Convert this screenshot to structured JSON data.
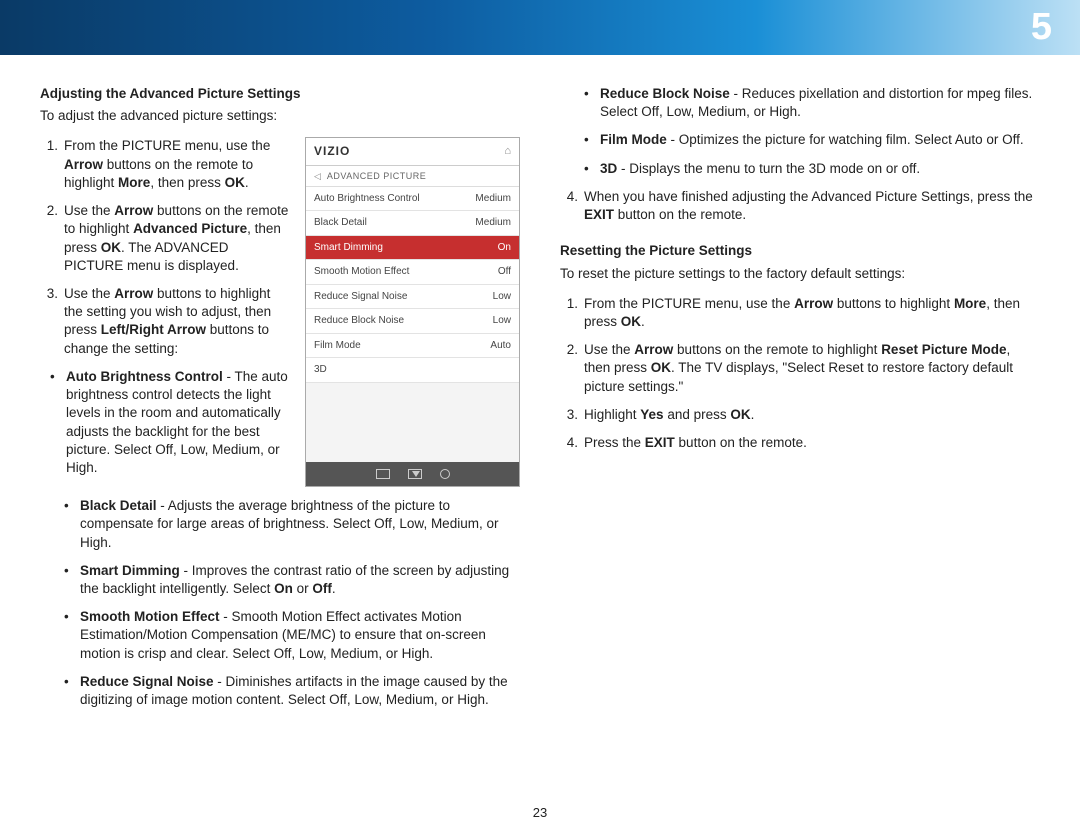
{
  "chapter_number": "5",
  "page_number": "23",
  "left": {
    "heading": "Adjusting the Advanced Picture Settings",
    "intro": "To adjust the advanced picture settings:",
    "step1_pre": "From the PICTURE menu, use the ",
    "step1_b1": "Arrow",
    "step1_mid": " buttons on the remote to highlight ",
    "step1_b2": "More",
    "step1_post": ", then press ",
    "step1_b3": "OK",
    "step1_end": ".",
    "step2_pre": "Use the ",
    "step2_b1": "Arrow",
    "step2_mid": " buttons on the remote to highlight ",
    "step2_b2": "Advanced Picture",
    "step2_post": ", then press ",
    "step2_b3": "OK",
    "step2_end": ". The ADVANCED PICTURE menu is displayed.",
    "step3_pre": "Use the ",
    "step3_b1": "Arrow",
    "step3_mid": " buttons to highlight the setting you wish to adjust, then press ",
    "step3_b2": "Left/Right Arrow",
    "step3_end": " buttons to change the setting:",
    "b_auto_t": "Auto Brightness Control",
    "b_auto": " - The auto brightness control detects the light levels in the room and automatically adjusts the backlight for the best picture. Select Off, Low, Medium, or High.",
    "b_black_t": "Black Detail",
    "b_black": " - Adjusts the average brightness of the picture to compensate for large areas of brightness. Select Off, Low, Medium, or High.",
    "b_smart_t": "Smart Dimming",
    "b_smart_a": " - Improves the contrast ratio of the screen by adjusting the backlight intelligently. Select ",
    "b_smart_on": "On",
    "b_smart_b": " or ",
    "b_smart_off": "Off",
    "b_smart_c": ".",
    "b_smooth_t": "Smooth Motion Effect",
    "b_smooth": " - Smooth Motion Effect activates Motion Estimation/Motion Compensation (ME/MC) to ensure that on-screen motion is crisp and clear. Select Off, Low, Medium, or High.",
    "b_signal_t": "Reduce Signal Noise",
    "b_signal": " - Diminishes artifacts in the image caused by the digitizing of image motion content. Select Off, Low, Medium, or High."
  },
  "menu": {
    "logo": "VIZIO",
    "title": "ADVANCED PICTURE",
    "rows": [
      {
        "label": "Auto Brightness Control",
        "value": "Medium",
        "selected": false
      },
      {
        "label": "Black Detail",
        "value": "Medium",
        "selected": false
      },
      {
        "label": "Smart Dimming",
        "value": "On",
        "selected": true
      },
      {
        "label": "Smooth Motion Effect",
        "value": "Off",
        "selected": false
      },
      {
        "label": "Reduce Signal Noise",
        "value": "Low",
        "selected": false
      },
      {
        "label": "Reduce Block Noise",
        "value": "Low",
        "selected": false
      },
      {
        "label": "Film Mode",
        "value": "Auto",
        "selected": false
      },
      {
        "label": "3D",
        "value": "",
        "selected": false
      }
    ]
  },
  "right": {
    "b_block_t": "Reduce Block Noise",
    "b_block": " - Reduces pixellation and distortion for mpeg files. Select Off, Low, Medium, or High.",
    "b_film_t": "Film Mode",
    "b_film": " - Optimizes the picture for watching film. Select Auto or Off.",
    "b_3d_t": "3D",
    "b_3d": " - Displays the menu to turn the 3D mode on or off.",
    "step4_pre": "When you have finished adjusting the Advanced Picture Settings, press the ",
    "step4_b": "EXIT",
    "step4_end": " button on the remote.",
    "heading2": "Resetting the Picture Settings",
    "intro2": "To reset the picture settings to the factory default settings:",
    "r1_pre": "From the PICTURE menu, use the ",
    "r1_b1": "Arrow",
    "r1_mid": " buttons to highlight ",
    "r1_b2": "More",
    "r1_post": ", then press ",
    "r1_b3": "OK",
    "r1_end": ".",
    "r2_pre": "Use the ",
    "r2_b1": "Arrow",
    "r2_mid": " buttons on the remote to highlight ",
    "r2_b2": "Reset Picture Mode",
    "r2_post": ", then press ",
    "r2_b3": "OK",
    "r2_end": ". The TV displays, \"Select Reset to restore factory default picture settings.\"",
    "r3_pre": "Highlight ",
    "r3_b1": "Yes",
    "r3_mid": " and press ",
    "r3_b2": "OK",
    "r3_end": ".",
    "r4_pre": "Press the ",
    "r4_b1": "EXIT",
    "r4_end": " button on the remote."
  }
}
